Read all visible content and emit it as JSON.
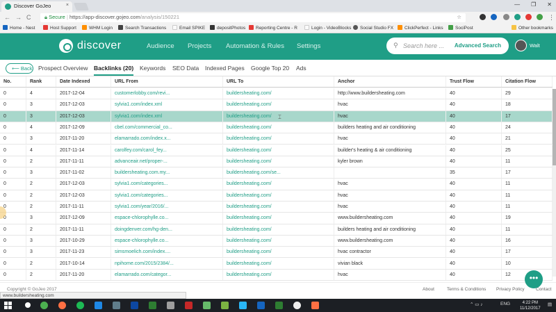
{
  "browser": {
    "tab_title": "Discover GoJeo",
    "tab_close": "×",
    "window_controls": [
      "—",
      "❐",
      "✕"
    ],
    "secure_label": "Secure",
    "url_domain": "https://app-discover.gojeo.com",
    "url_path": "/analysis/150221",
    "nav_back": "←",
    "nav_forward": "→",
    "nav_reload": "C",
    "bookmarks": [
      {
        "label": "Home - Nest",
        "color": "#1565c0"
      },
      {
        "label": "Host Support",
        "color": "#e53935"
      },
      {
        "label": "WHM Login",
        "color": "#ff8f00"
      },
      {
        "label": "Search Transactions",
        "color": "#424242"
      },
      {
        "label": "Email SPIKE",
        "color": "#fafafa"
      },
      {
        "label": "depositPhotos",
        "color": "#333333"
      },
      {
        "label": "Reporting Centre - R",
        "color": "#e53935"
      },
      {
        "label": "Login - VideoBlocks",
        "color": "#fafafa"
      },
      {
        "label": "Social Studio FX",
        "color": "#555555"
      },
      {
        "label": "ClickPerfect - Links",
        "color": "#ff8f00"
      },
      {
        "label": "SociPost",
        "color": "#43a047"
      }
    ],
    "other_bookmarks": "Other bookmarks"
  },
  "app": {
    "logo_text": "discover",
    "nav": [
      "Audience",
      "Projects",
      "Automation & Rules",
      "Settings"
    ],
    "search_placeholder": "Search here ...",
    "advanced_search": "Advanced Search",
    "username": "Walt",
    "brand_color": "#1f9e86"
  },
  "subnav": {
    "back": "Back",
    "tabs": [
      "Prospect Overview",
      "Backlinks (20)",
      "Keywords",
      "SEO Data",
      "Indexed Pages",
      "Google Top 20",
      "Ads"
    ],
    "active_tab": "Backlinks (20)"
  },
  "table": {
    "columns": [
      "No.",
      "Rank",
      "Date Indexed",
      "URL From",
      "URL To",
      "Anchor",
      "Trust Flow",
      "Citation Flow"
    ],
    "rows": [
      [
        "0",
        "4",
        "2017-12-04",
        "customerlobby.com/revi...",
        "buildersheating.com/",
        "http://www.buildersheating.com",
        "40",
        "29"
      ],
      [
        "0",
        "3",
        "2017-12-03",
        "sylvia1.com/index.xml",
        "buildersheating.com/",
        "hvac",
        "40",
        "18"
      ],
      [
        "0",
        "3",
        "2017-12-03",
        "sylvia1.com/index.xml",
        "buildersheating.com/",
        "hvac",
        "40",
        "17"
      ],
      [
        "0",
        "4",
        "2017-12-09",
        "cbel.com/commercial_co...",
        "buildersheating.com/",
        "builders heating and air conditioning",
        "40",
        "24"
      ],
      [
        "0",
        "3",
        "2017-11-20",
        "elamarrado.com/index.x...",
        "buildersheating.com/",
        "hvac",
        "40",
        "21"
      ],
      [
        "0",
        "4",
        "2017-11-14",
        "carolfey.com/carol_fey...",
        "buildersheating.com/",
        "builder's heating & air conditioning",
        "40",
        "25"
      ],
      [
        "0",
        "2",
        "2017-11-11",
        "advanceair.net/proper-...",
        "buildersheating.com/",
        "kyler brown",
        "40",
        "11"
      ],
      [
        "0",
        "3",
        "2017-11-02",
        "buildersheating.com.my...",
        "buildersheating.com/se...",
        "",
        "35",
        "17"
      ],
      [
        "0",
        "2",
        "2017-12-03",
        "sylvia1.com/categories...",
        "buildersheating.com/",
        "hvac",
        "40",
        "11"
      ],
      [
        "0",
        "2",
        "2017-12-03",
        "sylvia1.com/categories...",
        "buildersheating.com/",
        "hvac",
        "40",
        "11"
      ],
      [
        "0",
        "2",
        "2017-11-11",
        "sylvia1.com/year/2016/...",
        "buildersheating.com/",
        "hvac",
        "40",
        "11"
      ],
      [
        "0",
        "3",
        "2017-12-09",
        "espace-chlorophylle.co...",
        "buildersheating.com/",
        "www.buildersheating.com",
        "40",
        "19"
      ],
      [
        "0",
        "2",
        "2017-11-11",
        "doingdenver.com/hg-den...",
        "buildersheating.com/",
        "builders heating and air conditioning",
        "40",
        "11"
      ],
      [
        "0",
        "3",
        "2017-10-29",
        "espace-chlorophylle.co...",
        "buildersheating.com/",
        "www.buildersheating.com",
        "40",
        "16"
      ],
      [
        "0",
        "3",
        "2017-11-23",
        "simsmoelich.com/index....",
        "buildersheating.com/",
        "hvac contractor",
        "40",
        "17"
      ],
      [
        "0",
        "2",
        "2017-10-14",
        "npihome.com/2015/2384/...",
        "buildersheating.com/",
        "vivian black",
        "40",
        "10"
      ],
      [
        "0",
        "2",
        "2017-11-20",
        "elamarrado.com/categor...",
        "buildersheating.com/",
        "hvac",
        "40",
        "12"
      ]
    ],
    "highlighted_row": 2
  },
  "footer": {
    "copyright": "Copyright © GoJeo 2017",
    "status_url": "www.buildersheating.com",
    "links": [
      "About",
      "Terms & Conditions",
      "Privacy Policy",
      "Contact"
    ]
  },
  "taskbar": {
    "lang": "ENG",
    "time": "4:22 PM",
    "date": "11/12/2017"
  }
}
